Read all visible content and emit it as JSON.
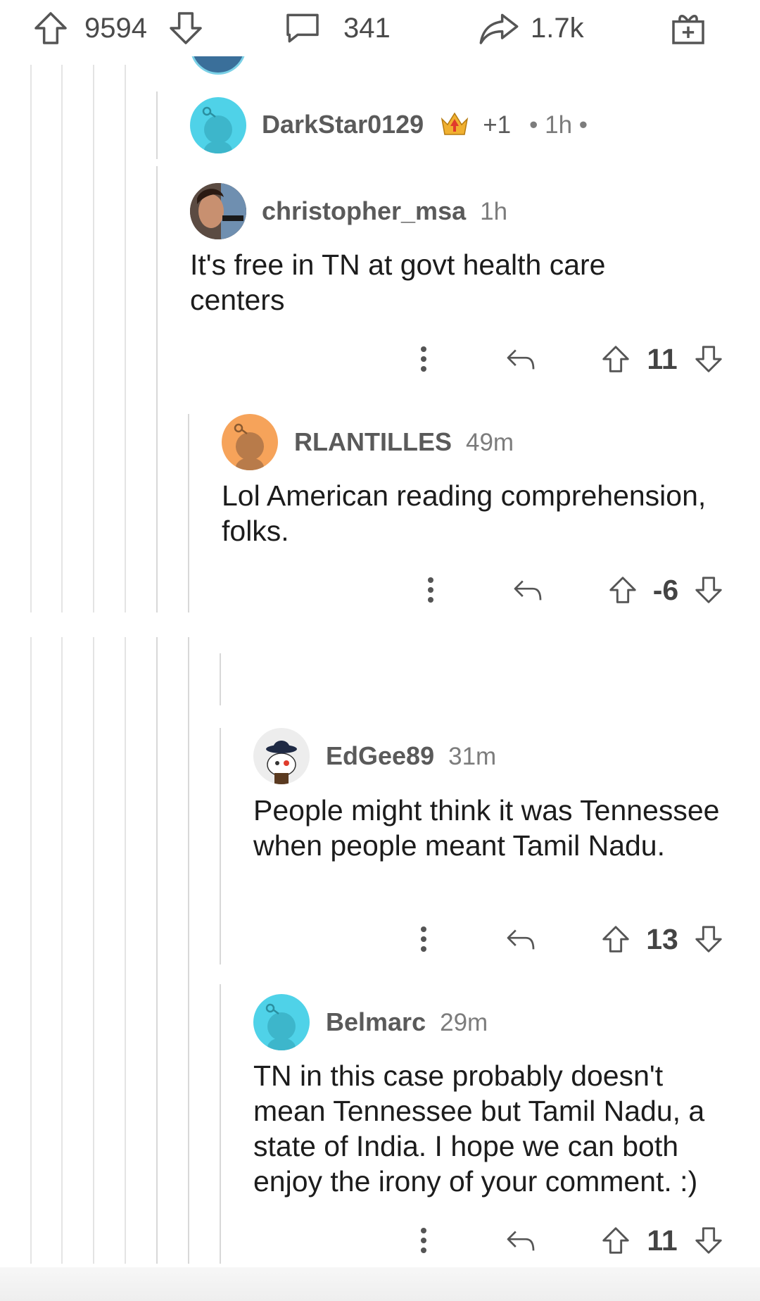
{
  "post_bar": {
    "upvotes": "9594",
    "comments": "341",
    "shares": "1.7k"
  },
  "comments": [
    {
      "username": "DarkStar0129",
      "award_count": "+1",
      "time": "• 1h •"
    },
    {
      "username": "christopher_msa",
      "time": "1h",
      "body": "It's free in TN at govt health care centers",
      "score": "11"
    },
    {
      "username": "RLANTILLES",
      "time": "49m",
      "body": "Lol American reading comprehension, folks.",
      "score": "-6"
    },
    {
      "username": "EdGee89",
      "time": "31m",
      "body": "People might think it was Tennessee when people meant Tamil Nadu.",
      "score": "13"
    },
    {
      "username": "Belmarc",
      "time": "29m",
      "body": "TN in this case probably doesn't mean Tennessee but Tamil Nadu, a state of India. I hope we can both enjoy the irony of your comment. :)",
      "score": "11"
    }
  ],
  "colors": {
    "avatar_teal": "#4fd2e8",
    "avatar_orange": "#f6a35a",
    "award_gold": "#f0b030",
    "award_red": "#e03c2c"
  },
  "icons": [
    "upvote-icon",
    "downvote-icon",
    "comment-icon",
    "share-icon",
    "gift-icon",
    "more-icon",
    "reply-icon",
    "award-icon"
  ]
}
